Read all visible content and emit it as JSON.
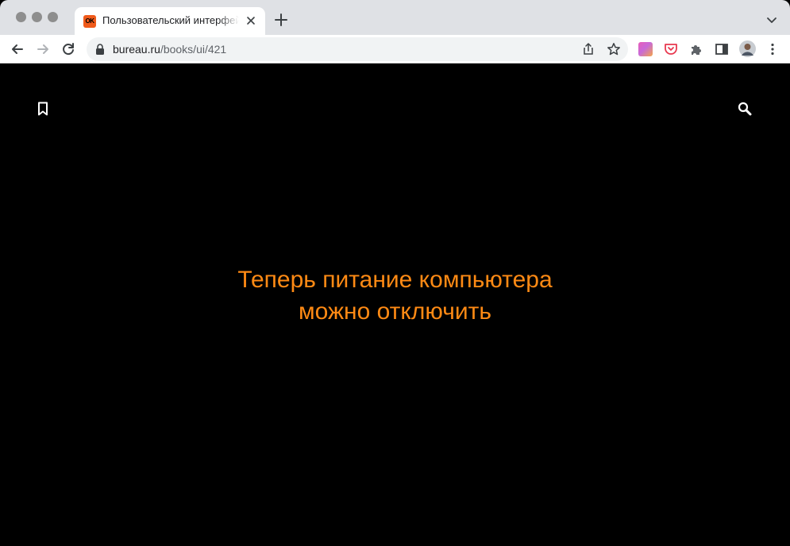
{
  "browser": {
    "tab": {
      "favicon_text": "OK",
      "title": "Пользовательский интерфейс"
    },
    "address": {
      "host": "bureau.ru",
      "path": "/books/ui/421"
    },
    "icons": {
      "tab_close": "close-icon",
      "new_tab": "plus-icon",
      "tab_search": "chevron-down-icon",
      "back": "arrow-left-icon",
      "forward": "arrow-right-icon",
      "reload": "reload-icon",
      "lock": "lock-icon",
      "share": "share-icon",
      "star": "star-icon",
      "extension_gradient": "gradient-extension-icon",
      "pocket": "pocket-icon",
      "puzzle": "puzzle-icon",
      "sidepanel": "side-panel-icon",
      "profile": "avatar",
      "menu": "kebab-menu-icon"
    }
  },
  "page": {
    "message_line1": "Теперь питание компьютера",
    "message_line2": "можно отключить",
    "accent_color": "#ff8a14",
    "background_color": "#000000",
    "icons": {
      "bookmark": "bookmark-icon",
      "search": "search-icon"
    }
  }
}
